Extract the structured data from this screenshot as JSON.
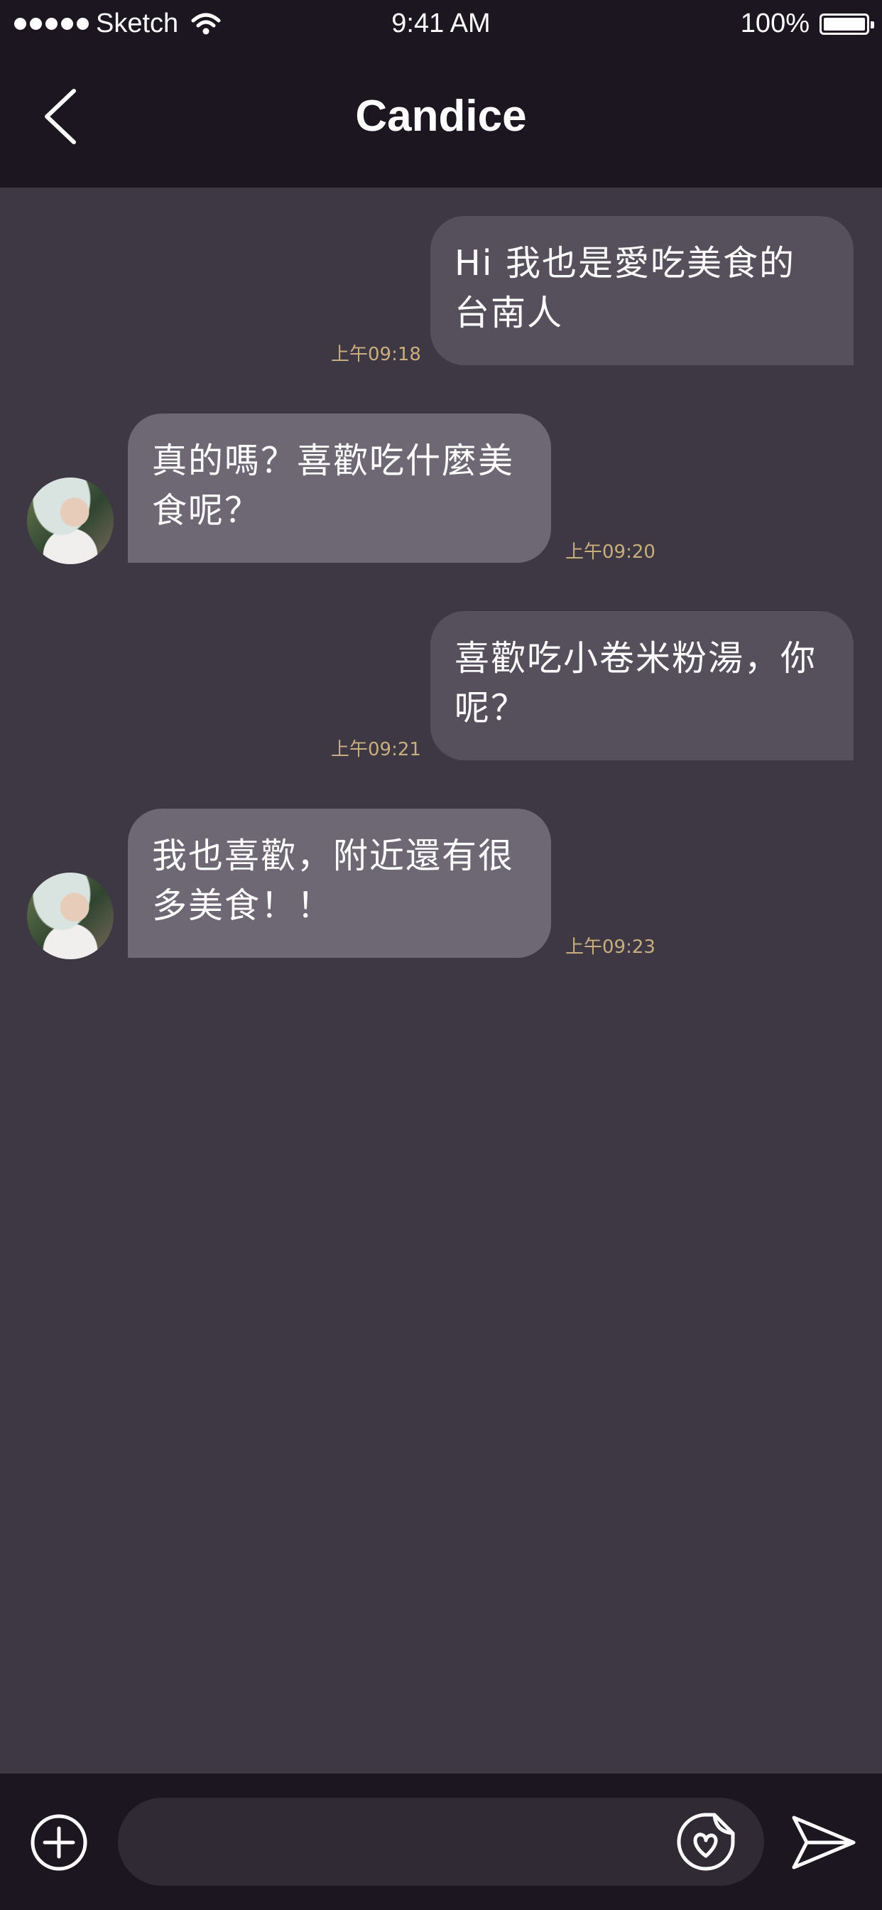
{
  "status_bar": {
    "carrier": "Sketch",
    "time": "9:41 AM",
    "battery": "100%"
  },
  "header": {
    "title": "Candice"
  },
  "messages": [
    {
      "direction": "sent",
      "text": "Hi 我也是愛吃美食的台南人",
      "time": "上午09:18"
    },
    {
      "direction": "received",
      "text": "真的嗎？喜歡吃什麼美食呢？",
      "time": "上午09:20"
    },
    {
      "direction": "sent",
      "text": "喜歡吃小卷米粉湯，你呢？",
      "time": "上午09:21"
    },
    {
      "direction": "received",
      "text": "我也喜歡，附近還有很多美食！！",
      "time": "上午09:23"
    }
  ],
  "composer": {
    "value": "",
    "placeholder": ""
  },
  "icons": {
    "back": "chevron-left-icon",
    "add": "plus-circle-icon",
    "sticker": "sticker-icon",
    "send": "send-icon"
  },
  "colors": {
    "bar_background": "#1c1621",
    "chat_background": "#3e3744",
    "sent_bubble": "#564f5c",
    "received_bubble": "#6e6774",
    "timestamp": "#c9ae7d"
  }
}
